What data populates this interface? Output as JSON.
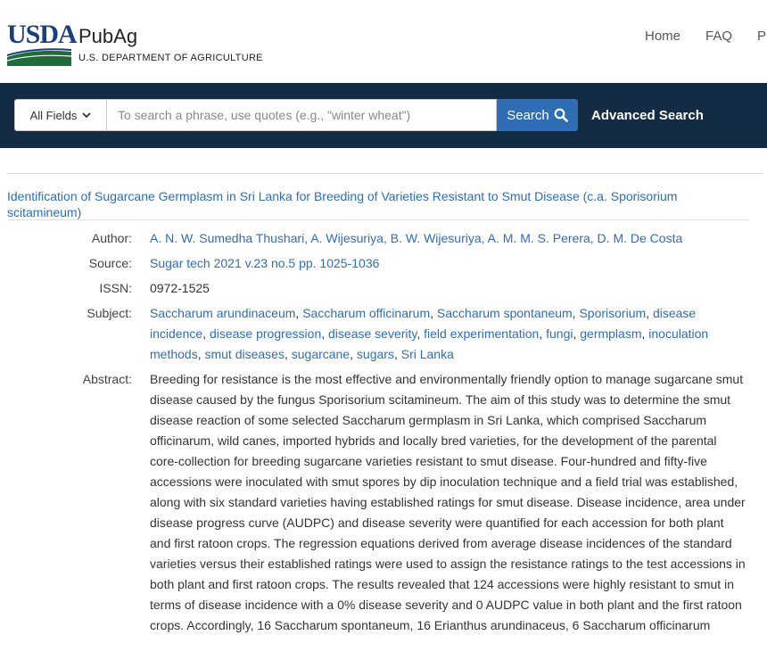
{
  "header": {
    "logo_text": "USDA",
    "site_name": "PubAg",
    "department": "U.S. DEPARTMENT OF AGRICULTURE",
    "nav": [
      "Home",
      "FAQ",
      "P"
    ]
  },
  "search": {
    "field_select": "All Fields",
    "placeholder": "To search a phrase, use quotes (e.g., \"winter wheat\")",
    "button_label": "Search",
    "advanced_label": "Advanced Search"
  },
  "record": {
    "title": "Identification of Sugarcane Germplasm in Sri Lanka for Breeding of Varieties Resistant to Smut Disease (c.a. Sporisorium scitamineum)",
    "author_label": "Author:",
    "authors": "A. N. W. Sumedha Thushari, A. Wijesuriya, B. W. Wijesuriya, A. M. M. S. Perera, D. M. De Costa",
    "source_label": "Source:",
    "source": "Sugar tech 2021 v.23 no.5 pp. 1025-1036",
    "issn_label": "ISSN:",
    "issn": "0972-1525",
    "subject_label": "Subject:",
    "subjects": [
      "Saccharum arundinaceum",
      "Saccharum officinarum",
      "Saccharum spontaneum",
      "Sporisorium",
      "disease incidence",
      "disease progression",
      "disease severity",
      "field experimentation",
      "fungi",
      "germplasm",
      "inoculation methods",
      "smut diseases",
      "sugarcane",
      "sugars",
      "Sri Lanka"
    ],
    "abstract_label": "Abstract:",
    "abstract": "Breeding for resistance is the most effective and environmentally friendly option to manage sugarcane smut disease caused by the fungus Sporisorium scitamineum. The aim of this study was to determine the smut disease reaction of some selected Saccharum germplasm in Sri Lanka, which comprised Saccharum officinarum, wild canes, imported hybrids and locally bred varieties, for the development of the parental core-collection for breeding sugarcane varieties resistant to smut disease. Four-hundred and fifty-five accessions were inoculated with smut spores by dip inoculation technique and a field trial was established, along with six standard varieties having established ratings for smut disease. Disease incidence, area under disease progress curve (AUDPC) and disease severity were quantified for each accession for both plant and first ratoon crops. The regression equations derived from average disease incidences of the standard varieties versus their established ratings were used to assign the resistance ratings to the test accessions in both plant and first ratoon crops. The results revealed that 124 accessions were highly resistant to smut in terms of disease incidence with a 0% disease severity and 0 AUDPC value in both plant and the first ratoon crops. Accordingly, 16 Saccharum spontaneum, 16 Erianthus arundinaceus, 6 Saccharum officinarum"
  },
  "colors": {
    "link": "#2f6eb5",
    "search_band": "#132b45",
    "usda_blue": "#1a3f7a",
    "usda_green": "#1f6b3a"
  }
}
